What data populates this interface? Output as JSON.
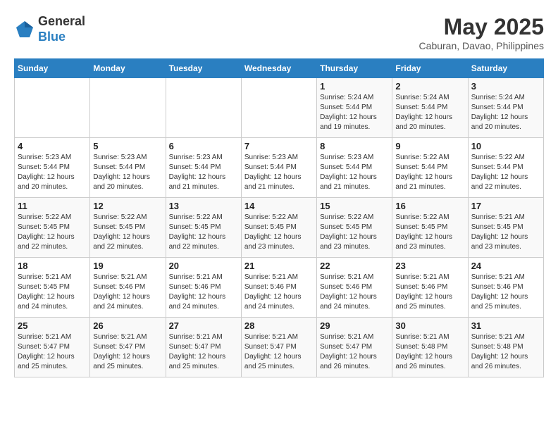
{
  "logo": {
    "line1": "General",
    "line2": "Blue"
  },
  "title": "May 2025",
  "subtitle": "Caburan, Davao, Philippines",
  "weekdays": [
    "Sunday",
    "Monday",
    "Tuesday",
    "Wednesday",
    "Thursday",
    "Friday",
    "Saturday"
  ],
  "weeks": [
    [
      {
        "day": "",
        "info": ""
      },
      {
        "day": "",
        "info": ""
      },
      {
        "day": "",
        "info": ""
      },
      {
        "day": "",
        "info": ""
      },
      {
        "day": "1",
        "info": "Sunrise: 5:24 AM\nSunset: 5:44 PM\nDaylight: 12 hours\nand 19 minutes."
      },
      {
        "day": "2",
        "info": "Sunrise: 5:24 AM\nSunset: 5:44 PM\nDaylight: 12 hours\nand 20 minutes."
      },
      {
        "day": "3",
        "info": "Sunrise: 5:24 AM\nSunset: 5:44 PM\nDaylight: 12 hours\nand 20 minutes."
      }
    ],
    [
      {
        "day": "4",
        "info": "Sunrise: 5:23 AM\nSunset: 5:44 PM\nDaylight: 12 hours\nand 20 minutes."
      },
      {
        "day": "5",
        "info": "Sunrise: 5:23 AM\nSunset: 5:44 PM\nDaylight: 12 hours\nand 20 minutes."
      },
      {
        "day": "6",
        "info": "Sunrise: 5:23 AM\nSunset: 5:44 PM\nDaylight: 12 hours\nand 21 minutes."
      },
      {
        "day": "7",
        "info": "Sunrise: 5:23 AM\nSunset: 5:44 PM\nDaylight: 12 hours\nand 21 minutes."
      },
      {
        "day": "8",
        "info": "Sunrise: 5:23 AM\nSunset: 5:44 PM\nDaylight: 12 hours\nand 21 minutes."
      },
      {
        "day": "9",
        "info": "Sunrise: 5:22 AM\nSunset: 5:44 PM\nDaylight: 12 hours\nand 21 minutes."
      },
      {
        "day": "10",
        "info": "Sunrise: 5:22 AM\nSunset: 5:44 PM\nDaylight: 12 hours\nand 22 minutes."
      }
    ],
    [
      {
        "day": "11",
        "info": "Sunrise: 5:22 AM\nSunset: 5:45 PM\nDaylight: 12 hours\nand 22 minutes."
      },
      {
        "day": "12",
        "info": "Sunrise: 5:22 AM\nSunset: 5:45 PM\nDaylight: 12 hours\nand 22 minutes."
      },
      {
        "day": "13",
        "info": "Sunrise: 5:22 AM\nSunset: 5:45 PM\nDaylight: 12 hours\nand 22 minutes."
      },
      {
        "day": "14",
        "info": "Sunrise: 5:22 AM\nSunset: 5:45 PM\nDaylight: 12 hours\nand 23 minutes."
      },
      {
        "day": "15",
        "info": "Sunrise: 5:22 AM\nSunset: 5:45 PM\nDaylight: 12 hours\nand 23 minutes."
      },
      {
        "day": "16",
        "info": "Sunrise: 5:22 AM\nSunset: 5:45 PM\nDaylight: 12 hours\nand 23 minutes."
      },
      {
        "day": "17",
        "info": "Sunrise: 5:21 AM\nSunset: 5:45 PM\nDaylight: 12 hours\nand 23 minutes."
      }
    ],
    [
      {
        "day": "18",
        "info": "Sunrise: 5:21 AM\nSunset: 5:45 PM\nDaylight: 12 hours\nand 24 minutes."
      },
      {
        "day": "19",
        "info": "Sunrise: 5:21 AM\nSunset: 5:46 PM\nDaylight: 12 hours\nand 24 minutes."
      },
      {
        "day": "20",
        "info": "Sunrise: 5:21 AM\nSunset: 5:46 PM\nDaylight: 12 hours\nand 24 minutes."
      },
      {
        "day": "21",
        "info": "Sunrise: 5:21 AM\nSunset: 5:46 PM\nDaylight: 12 hours\nand 24 minutes."
      },
      {
        "day": "22",
        "info": "Sunrise: 5:21 AM\nSunset: 5:46 PM\nDaylight: 12 hours\nand 24 minutes."
      },
      {
        "day": "23",
        "info": "Sunrise: 5:21 AM\nSunset: 5:46 PM\nDaylight: 12 hours\nand 25 minutes."
      },
      {
        "day": "24",
        "info": "Sunrise: 5:21 AM\nSunset: 5:46 PM\nDaylight: 12 hours\nand 25 minutes."
      }
    ],
    [
      {
        "day": "25",
        "info": "Sunrise: 5:21 AM\nSunset: 5:47 PM\nDaylight: 12 hours\nand 25 minutes."
      },
      {
        "day": "26",
        "info": "Sunrise: 5:21 AM\nSunset: 5:47 PM\nDaylight: 12 hours\nand 25 minutes."
      },
      {
        "day": "27",
        "info": "Sunrise: 5:21 AM\nSunset: 5:47 PM\nDaylight: 12 hours\nand 25 minutes."
      },
      {
        "day": "28",
        "info": "Sunrise: 5:21 AM\nSunset: 5:47 PM\nDaylight: 12 hours\nand 25 minutes."
      },
      {
        "day": "29",
        "info": "Sunrise: 5:21 AM\nSunset: 5:47 PM\nDaylight: 12 hours\nand 26 minutes."
      },
      {
        "day": "30",
        "info": "Sunrise: 5:21 AM\nSunset: 5:48 PM\nDaylight: 12 hours\nand 26 minutes."
      },
      {
        "day": "31",
        "info": "Sunrise: 5:21 AM\nSunset: 5:48 PM\nDaylight: 12 hours\nand 26 minutes."
      }
    ]
  ]
}
